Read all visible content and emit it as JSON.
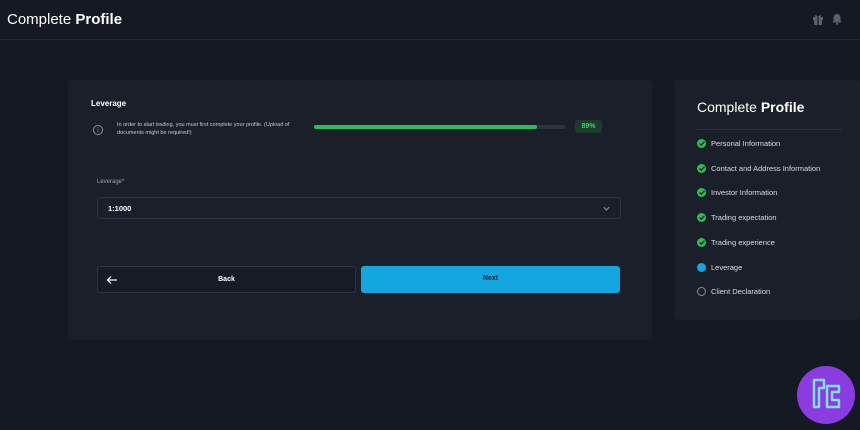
{
  "header": {
    "title_regular": "Complete",
    "title_bold": "Profile",
    "icons": [
      "gift-icon",
      "bell-icon"
    ]
  },
  "form": {
    "section_title": "Leverage",
    "info_text": "In order to start trading, you must first complete your profile. (Upload of documents might be required!)",
    "progress": {
      "percent": 89,
      "label": "89%"
    },
    "leverage_label": "Leverage*",
    "leverage_value": "1:1000",
    "back_label": "Back",
    "next_label": "Next"
  },
  "steps_panel": {
    "title_regular": "Complete",
    "title_bold": "Profile",
    "steps": [
      {
        "label": "Personal Information",
        "status": "done"
      },
      {
        "label": "Contact and Address Information",
        "status": "done"
      },
      {
        "label": "Investor Information",
        "status": "done"
      },
      {
        "label": "Trading expectation",
        "status": "done"
      },
      {
        "label": "Trading experience",
        "status": "done"
      },
      {
        "label": "Leverage",
        "status": "current"
      },
      {
        "label": "Client Declaration",
        "status": "pending"
      }
    ]
  },
  "colors": {
    "background": "#151923",
    "card": "#1b1f2a",
    "accent_blue": "#13a6e0",
    "success_green": "#2dbd58",
    "logo_purple": "#8a3ce0"
  }
}
